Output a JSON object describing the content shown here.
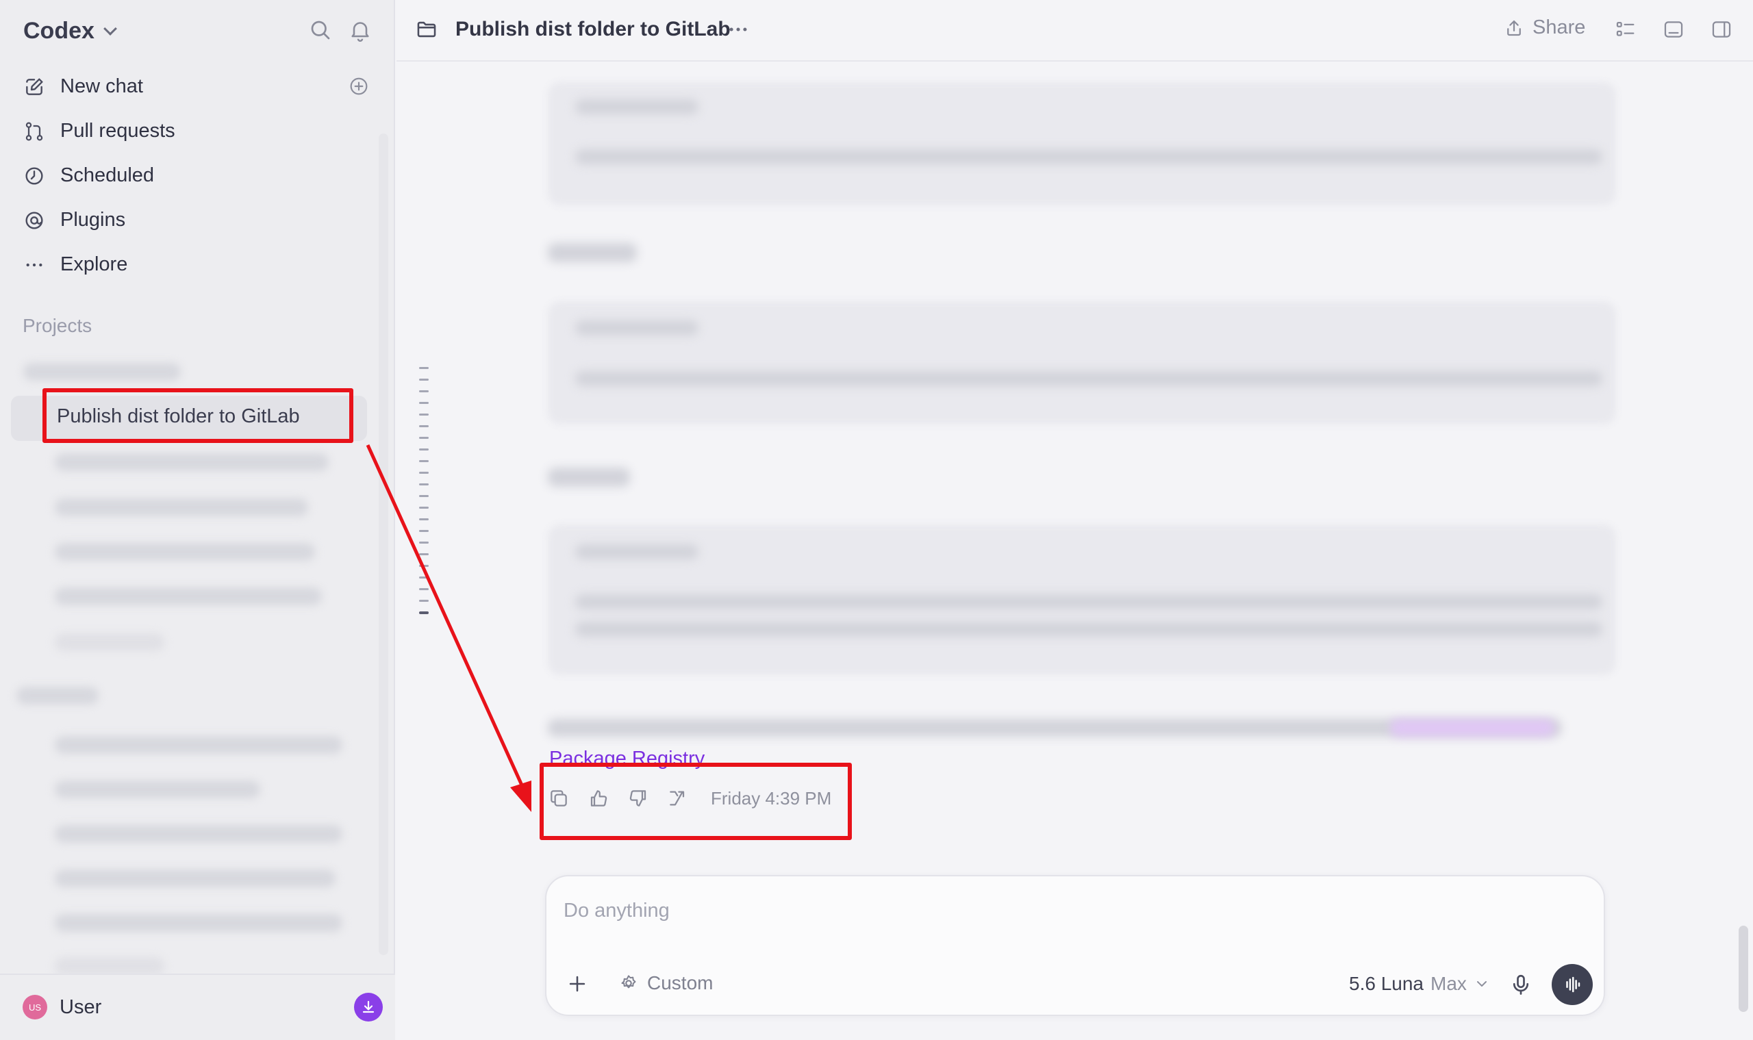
{
  "sidebar": {
    "brand": "Codex",
    "nav": [
      {
        "label": "New chat",
        "icon": "edit-icon"
      },
      {
        "label": "Pull requests",
        "icon": "pull-request-icon"
      },
      {
        "label": "Scheduled",
        "icon": "clock-icon"
      },
      {
        "label": "Plugins",
        "icon": "plugin-icon"
      },
      {
        "label": "Explore",
        "icon": "dots-icon"
      }
    ],
    "projects_label": "Projects",
    "active_chat": "Publish dist folder to GitLab",
    "user": {
      "initials": "US",
      "name": "User"
    }
  },
  "header": {
    "title": "Publish dist folder to GitLab",
    "share_label": "Share"
  },
  "message": {
    "link_text": "Package Registry",
    "timestamp": "Friday 4:39 PM"
  },
  "composer": {
    "placeholder": "Do anything",
    "custom_label": "Custom",
    "model_name": "5.6 Luna",
    "model_variant": "Max"
  },
  "colors": {
    "accent": "#7b2fe0",
    "annotation": "#e8121a",
    "background": "#f4f4f7",
    "sidebar": "#ededf0"
  }
}
